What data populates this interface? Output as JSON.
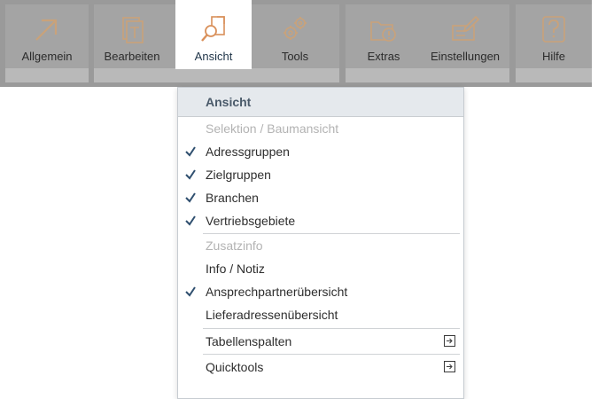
{
  "toolbar": {
    "items": [
      {
        "label": "Allgemein",
        "icon": "arrow-up-right-icon"
      },
      {
        "label": "Bearbeiten",
        "icon": "edit-pages-icon"
      },
      {
        "label": "Ansicht",
        "icon": "view-search-icon",
        "active": true
      },
      {
        "label": "Tools",
        "icon": "gears-icon"
      },
      {
        "label": "Extras",
        "icon": "folder-info-icon"
      },
      {
        "label": "Einstellungen",
        "icon": "settings-pen-icon"
      },
      {
        "label": "Hilfe",
        "icon": "question-icon"
      }
    ],
    "colors": {
      "icon": "#c9a27a",
      "active_icon": "#d9905a",
      "bar": "#9a9a9a",
      "check": "#2f4f6f"
    }
  },
  "menu": {
    "title": "Ansicht",
    "sections": [
      {
        "header": "Selektion / Baumansicht",
        "items": [
          {
            "label": "Adressgruppen",
            "checked": true
          },
          {
            "label": "Zielgruppen",
            "checked": true
          },
          {
            "label": "Branchen",
            "checked": true
          },
          {
            "label": "Vertriebsgebiete",
            "checked": true
          }
        ]
      },
      {
        "header": "Zusatzinfo",
        "items": [
          {
            "label": "Info / Notiz",
            "checked": false
          },
          {
            "label": "Ansprechpartnerübersicht",
            "checked": true
          },
          {
            "label": "Lieferadressenübersicht",
            "checked": false
          }
        ]
      }
    ],
    "submenus": [
      {
        "label": "Tabellenspalten",
        "icon": "submenu-arrow-icon"
      },
      {
        "label": "Quicktools",
        "icon": "submenu-arrow-icon"
      }
    ]
  }
}
